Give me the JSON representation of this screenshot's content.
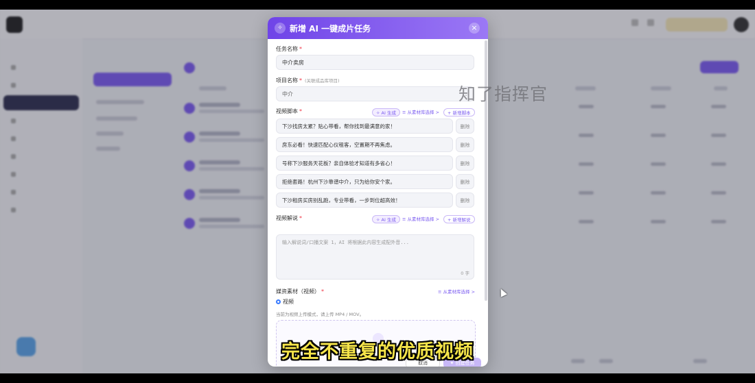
{
  "modal": {
    "title": "新增 AI 一键成片任务",
    "close": "×",
    "task_name_label": "任务名称",
    "task_name_value": "中介卖房",
    "project_label": "项目名称",
    "project_hint": "(关联成品库项目)",
    "project_value": "中介",
    "script_label": "视频脚本",
    "script_ai": "✧ AI 生成",
    "script_lib": "≡ 从素材库选择 >",
    "script_add": "+ 新增脚本",
    "scripts": [
      "下沙找房太累？贴心带看，帮你找到最满意的家！",
      "房东必看！快速匹配心仪租客，空置期不再焦虑。",
      "号称下沙服务天花板？亲自体验才知道有多省心！",
      "拒绝套路！杭州下沙靠谱中介，只为给你安个家。",
      "下沙租房买房别乱跑，专业带看，一步到位超高效！"
    ],
    "delete_label": "删除",
    "narration_label": "视频解说",
    "narration_ai": "✧ AI 生成",
    "narration_lib": "≡ 从素材库选择 >",
    "narration_add": "+ 新增解说",
    "narration_placeholder": "输入解说词/口播文案 1，AI 将根据此内容生成配外音...",
    "narration_count": "0 字",
    "media_label": "媒资素材（视频）",
    "media_lib": "≡ 从素材库选择 >",
    "media_option": "视频",
    "media_note": "当前为视频上传模式，请上传 MP4 / MOV。",
    "cancel": "取消",
    "create": "✦ 创建任务"
  },
  "watermark": "知了指挥官",
  "subtitle": "完全不重复的优质视频",
  "required_mark": "*"
}
